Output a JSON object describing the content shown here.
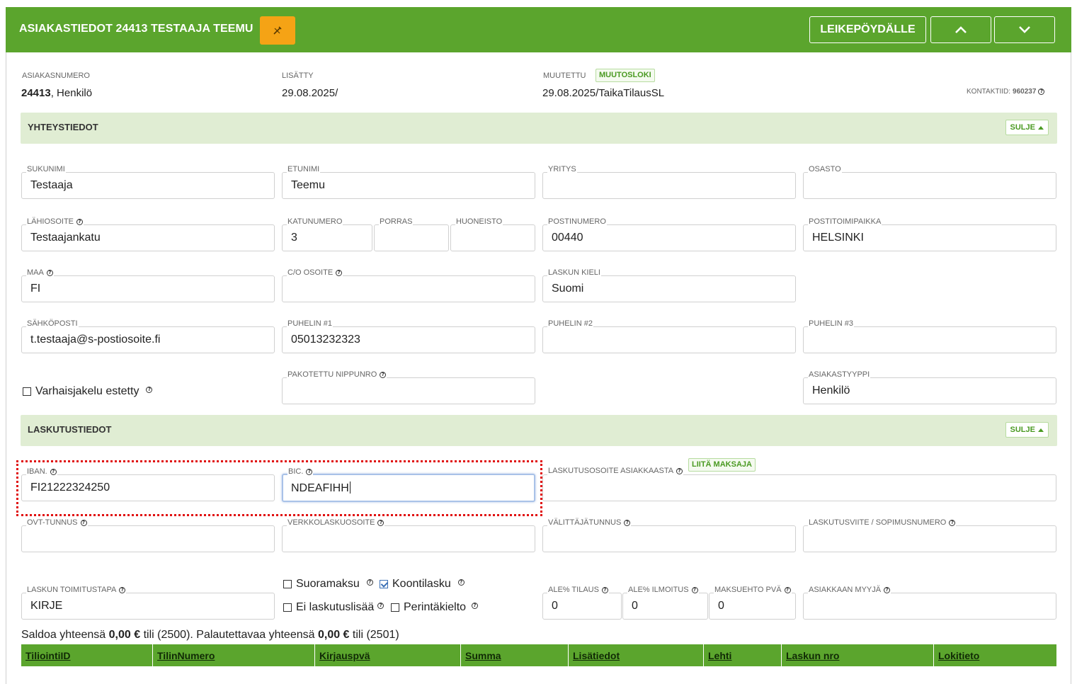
{
  "header": {
    "title": "ASIAKASTIEDOT 24413 TESTAAJA TEEMU",
    "clipboard_label": "LEIKEPÖYDÄLLE"
  },
  "meta": {
    "asiakasnumero_label": "ASIAKASNUMERO",
    "asiakasnumero": "24413",
    "asiakastyyppi_suffix": ", Henkilö",
    "lisatty_label": "LISÄTTY",
    "lisatty": "29.08.2025/",
    "muutettu_label": "MUUTETTU",
    "muutosloki_label": "MUUTOSLOKI",
    "muutettu": "29.08.2025/TaikaTilausSL",
    "kontaktiid_label": "KONTAKTIID:",
    "kontaktiid": "960237"
  },
  "sections": {
    "yhteystiedot": "YHTEYSTIEDOT",
    "laskutustiedot": "LASKUTUSTIEDOT",
    "sulje_label": "SULJE"
  },
  "contact": {
    "sukunimi_label": "SUKUNIMI",
    "sukunimi": "Testaaja",
    "etunimi_label": "ETUNIMI",
    "etunimi": "Teemu",
    "yritys_label": "YRITYS",
    "yritys": "",
    "osasto_label": "OSASTO",
    "osasto": "",
    "lahiosoite_label": "LÄHIOSOITE",
    "lahiosoite": "Testaajankatu",
    "katunumero_label": "KATUNUMERO",
    "katunumero": "3",
    "porras_label": "PORRAS",
    "porras": "",
    "huoneisto_label": "HUONEISTO",
    "huoneisto": "",
    "postinumero_label": "POSTINUMERO",
    "postinumero": "00440",
    "postitoimipaikka_label": "POSTITOIMIPAIKKA",
    "postitoimipaikka": "HELSINKI",
    "maa_label": "MAA",
    "maa": "FI",
    "co_label": "C/O OSOITE",
    "co": "",
    "laskun_kieli_label": "LASKUN KIELI",
    "laskun_kieli": "Suomi",
    "sahkoposti_label": "SÄHKÖPOSTI",
    "sahkoposti": "t.testaaja@s-postiosoite.fi",
    "puhelin1_label": "PUHELIN #1",
    "puhelin1": "05013232323",
    "puhelin2_label": "PUHELIN #2",
    "puhelin2": "",
    "puhelin3_label": "PUHELIN #3",
    "puhelin3": "",
    "varhaisjakelu_label": "Varhaisjakelu estetty",
    "nippunro_label": "PAKOTETTU NIPPUNRO",
    "nippunro": "",
    "asiakastyyppi_label": "ASIAKASTYYPPI",
    "asiakastyyppi": "Henkilö"
  },
  "billing": {
    "iban_label": "IBAN.",
    "iban": "FI21222324250",
    "bic_label": "BIC.",
    "bic": "NDEAFIHH",
    "laskutusosoite_label": "LASKUTUSOSOITE ASIAKKAASTA",
    "liita_maksaja_label": "LIITÄ MAKSAJA",
    "laskutusosoite": "",
    "ovt_label": "OVT-TUNNUS",
    "ovt": "",
    "verkkolaskuosoite_label": "VERKKOLASKUOSOITE",
    "verkkolaskuosoite": "",
    "valittaja_label": "VÄLITTÄJÄTUNNUS",
    "valittaja": "",
    "laskutusviite_label": "LASKUTUSVIITE / SOPIMUSNUMERO",
    "laskutusviite": "",
    "toimitustapa_label": "LASKUN TOIMITUSTAPA",
    "toimitustapa": "KIRJE",
    "suoramaksu_label": "Suoramaksu",
    "koontilasku_label": "Koontilasku",
    "ei_laskutuslisaa_label": "Ei laskutuslisää",
    "perintakielto_label": "Perintäkielto",
    "ale_tilaus_label": "ALE% TILAUS",
    "ale_tilaus": "0",
    "ale_ilmoitus_label": "ALE% ILMOITUS",
    "ale_ilmoitus": "0",
    "maksuehto_label": "MAKSUEHTO PVÄ",
    "maksuehto": "0",
    "myyja_label": "ASIAKKAAN MYYJÄ",
    "myyja": ""
  },
  "saldo": {
    "prefix": "Saldoa yhteensä ",
    "saldo_amount": "0,00 €",
    "middle": " tili (2500). Palautettavaa yhteensä ",
    "palautettava_amount": "0,00 €",
    "suffix": " tili (2501)"
  },
  "ledger_columns": [
    "TiliointiID",
    "TilinNumero",
    "Kirjauspvä",
    "Summa",
    "Lisätiedot",
    "Lehti",
    "Laskun nro",
    "Lokitieto"
  ],
  "colors": {
    "brand_green": "#5ba52d",
    "section_green": "#e0edd3",
    "edit_orange": "#f5a315",
    "highlight_red": "#e01010"
  },
  "icons": [
    "edit-pen-icon",
    "chevron-up-icon",
    "chevron-down-icon",
    "help-icon",
    "triangle-up-icon"
  ]
}
